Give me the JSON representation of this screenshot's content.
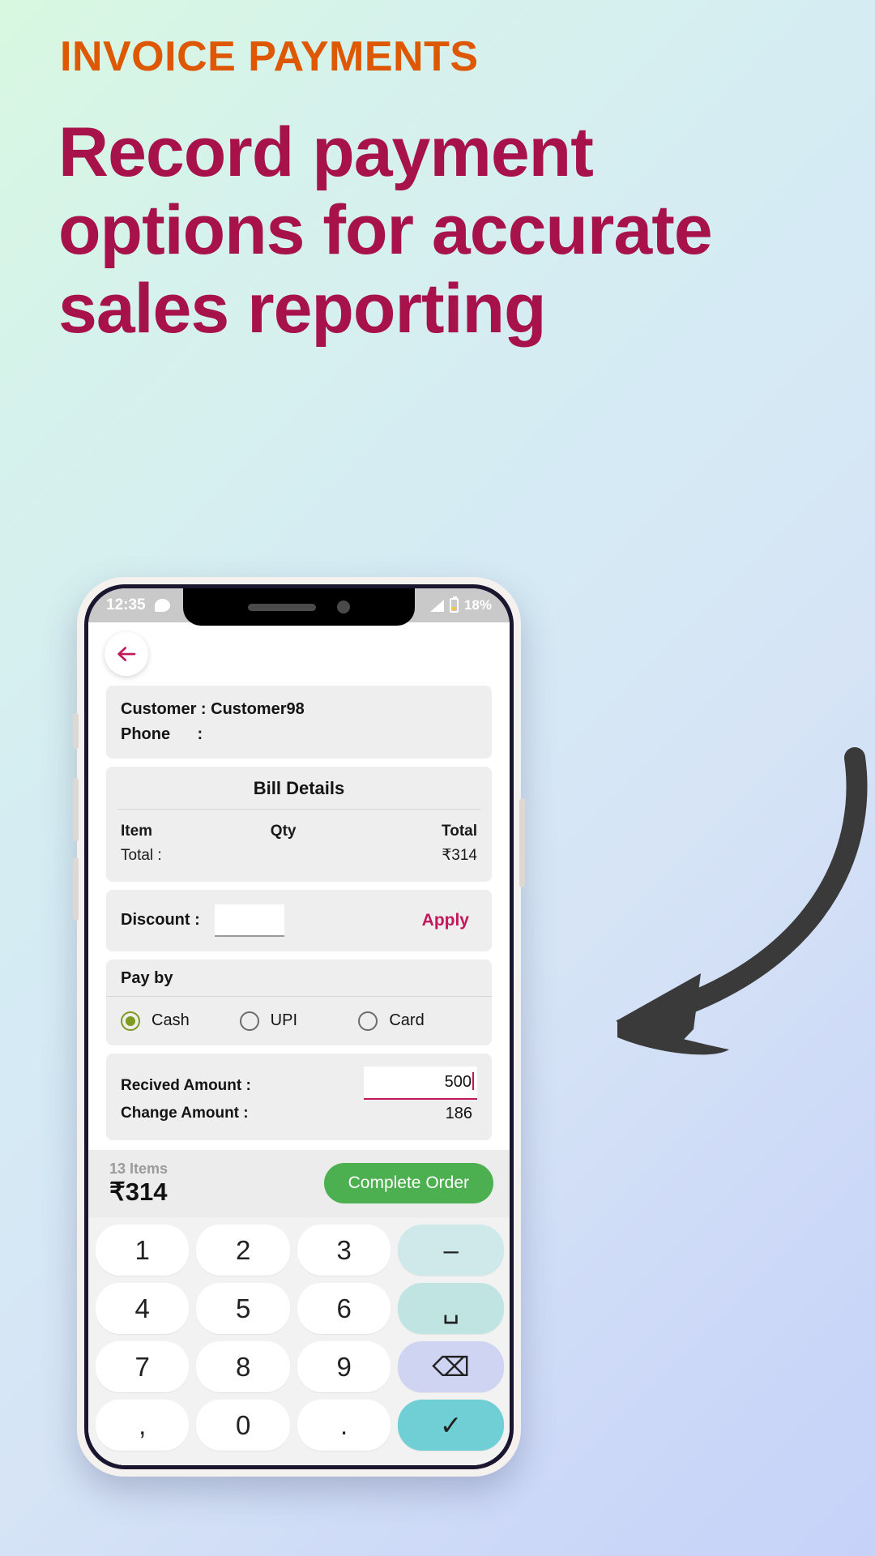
{
  "promo": {
    "eyebrow": "INVOICE PAYMENTS",
    "headline": "Record payment options for accurate sales reporting",
    "eyebrow_color": "#DD5800",
    "headline_color": "#A8124B"
  },
  "status_bar": {
    "time": "12:35",
    "chat_icon": "chat-bubble-icon",
    "signal_icon": "signal-bars-icon",
    "battery_icon": "battery-icon",
    "battery_percent": "18%"
  },
  "app_bar": {
    "back_icon": "arrow-left-icon"
  },
  "customer": {
    "name_row": "Customer : Customer98",
    "phone_row": "Phone      :"
  },
  "bill": {
    "title": "Bill Details",
    "headers": [
      "Item",
      "Qty",
      "Total"
    ],
    "rows": [
      [
        "Total :",
        "",
        "₹314"
      ]
    ]
  },
  "discount": {
    "label": "Discount :",
    "value": "",
    "apply_label": "Apply"
  },
  "pay_by": {
    "title": "Pay by",
    "options": [
      {
        "label": "Cash",
        "selected": true
      },
      {
        "label": "UPI",
        "selected": false
      },
      {
        "label": "Card",
        "selected": false
      }
    ],
    "selected_color": "#7F9A20"
  },
  "amounts": {
    "received_label": "Recived Amount :",
    "received_value": "500",
    "change_label": "Change Amount :",
    "change_value": "186",
    "field_underline_color": "#C2185B"
  },
  "summary": {
    "items": "13 Items",
    "total": "₹314",
    "button_label": "Complete Order",
    "button_color": "#4CAF50"
  },
  "keypad": {
    "rows": [
      [
        {
          "label": "1",
          "name": "key-1",
          "type": "num"
        },
        {
          "label": "2",
          "name": "key-2",
          "type": "num"
        },
        {
          "label": "3",
          "name": "key-3",
          "type": "num"
        },
        {
          "label": "–",
          "name": "minus-key",
          "type": "fn1"
        }
      ],
      [
        {
          "label": "4",
          "name": "key-4",
          "type": "num"
        },
        {
          "label": "5",
          "name": "key-5",
          "type": "num"
        },
        {
          "label": "6",
          "name": "key-6",
          "type": "num"
        },
        {
          "label": "␣",
          "name": "space-key",
          "type": "fn2"
        }
      ],
      [
        {
          "label": "7",
          "name": "key-7",
          "type": "num"
        },
        {
          "label": "8",
          "name": "key-8",
          "type": "num"
        },
        {
          "label": "9",
          "name": "key-9",
          "type": "num"
        },
        {
          "label": "⌫",
          "name": "backspace-key",
          "type": "fn3"
        }
      ],
      [
        {
          "label": ",",
          "name": "comma-key",
          "type": "num"
        },
        {
          "label": "0",
          "name": "key-0",
          "type": "num"
        },
        {
          "label": ".",
          "name": "dot-key",
          "type": "num"
        },
        {
          "label": "✓",
          "name": "enter-key",
          "type": "fn4"
        }
      ]
    ],
    "collapse_icon": "chevron-down-icon"
  }
}
